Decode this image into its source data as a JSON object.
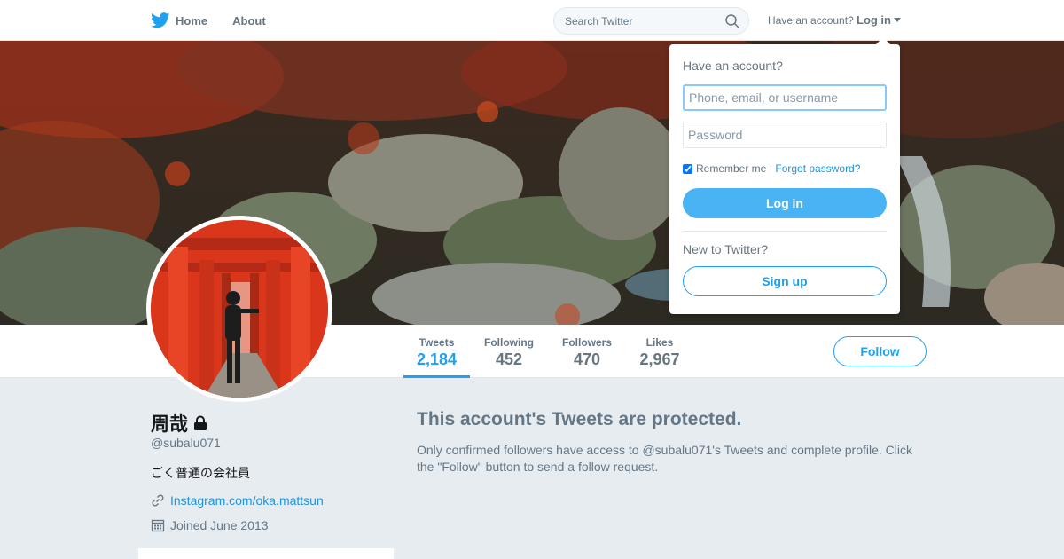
{
  "nav": {
    "home_label": "Home",
    "about_label": "About",
    "search_placeholder": "Search Twitter",
    "have_account": "Have an account?",
    "login_label": "Log in"
  },
  "profile": {
    "name": "周哉",
    "handle": "@subalu071",
    "bio": "ごく普通の会社員",
    "website": "Instagram.com/oka.mattsun",
    "joined": "Joined June 2013"
  },
  "stats": [
    {
      "label": "Tweets",
      "value": "2,184",
      "active": true
    },
    {
      "label": "Following",
      "value": "452",
      "active": false
    },
    {
      "label": "Followers",
      "value": "470",
      "active": false
    },
    {
      "label": "Likes",
      "value": "2,967",
      "active": false
    }
  ],
  "follow_label": "Follow",
  "protected": {
    "title": "This account's Tweets are protected.",
    "message": "Only confirmed followers have access to @subalu071's Tweets and complete profile. Click the \"Follow\" button to send a follow request."
  },
  "login_dropdown": {
    "heading": "Have an account?",
    "username_placeholder": "Phone, email, or username",
    "password_placeholder": "Password",
    "remember_me": "Remember me",
    "separator": "·",
    "forgot_password": "Forgot password?",
    "login_button": "Log in",
    "new_heading": "New to Twitter?",
    "signup_button": "Sign up"
  },
  "colors": {
    "accent": "#1da1f2",
    "link": "#1b95e0",
    "background": "#e6ecf0"
  },
  "icons": [
    "twitter-bird-icon",
    "search-icon",
    "caret-down-icon",
    "lock-icon",
    "link-icon",
    "calendar-icon"
  ]
}
